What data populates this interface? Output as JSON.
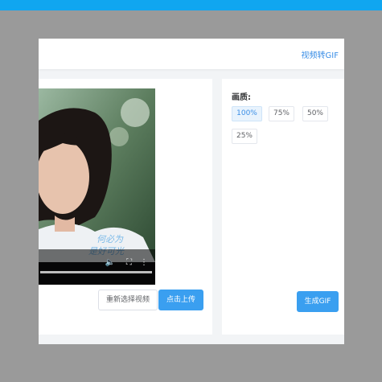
{
  "header": {
    "link_label": "视频转GIF"
  },
  "video": {
    "caption_line1": "何必为",
    "caption_line2": "是好可光",
    "controls": {
      "volume_icon": "speaker-icon",
      "fullscreen_icon": "fullscreen-icon",
      "more_icon": "more-vertical-icon"
    }
  },
  "upload": {
    "reselect_label": "重新选择视频",
    "upload_label": "点击上传"
  },
  "quality": {
    "label": "画质:",
    "options": [
      "100%",
      "75%",
      "50%",
      "25%"
    ],
    "selected": "100%"
  },
  "generate": {
    "label": "生成GIF"
  },
  "colors": {
    "accent": "#3a9ff0",
    "topbar": "#10a6f0",
    "backdrop": "#9a9a9a"
  }
}
